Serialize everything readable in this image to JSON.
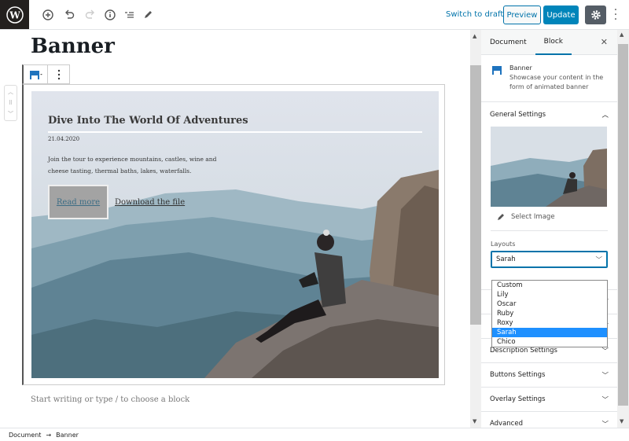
{
  "toolbar": {
    "switch_to_draft": "Switch to draft",
    "preview": "Preview",
    "update": "Update",
    "icons": [
      "wordpress-logo",
      "add-block-icon",
      "undo-icon",
      "redo-icon",
      "info-icon",
      "list-view-icon",
      "edit-icon",
      "gear-icon",
      "more-icon"
    ]
  },
  "post": {
    "title": "Banner",
    "placeholder": "Start writing or type / to choose a block"
  },
  "banner": {
    "heading": "Dive Into The World Of Adventures",
    "date": "21.04.2020",
    "description": "Join the tour to experience mountains, castles, wine and cheese tasting, thermal baths, lakes, waterfalls.",
    "read_more": "Read more",
    "download": "Download the file"
  },
  "sidebar": {
    "tabs": [
      {
        "label": "Document"
      },
      {
        "label": "Block"
      }
    ],
    "active_tab": "Block",
    "block_name": "Banner",
    "block_description": "Showcase your content in the form of animated banner",
    "general_settings": "General Settings",
    "select_image": "Select Image",
    "layouts_label": "Layouts",
    "layout_value": "Sarah",
    "layout_options": [
      "Custom",
      "Lily",
      "Oscar",
      "Ruby",
      "Roxy",
      "Sarah",
      "Chico"
    ],
    "panels": [
      {
        "label": ""
      },
      {
        "label": ""
      },
      {
        "label": "Description Settings"
      },
      {
        "label": "Buttons Settings"
      },
      {
        "label": "Overlay Settings"
      },
      {
        "label": "Advanced"
      }
    ]
  },
  "breadcrumb": {
    "items": [
      "Document",
      "Banner"
    ],
    "separator": "→"
  },
  "colors": {
    "accent": "#0073aa",
    "update": "#0085ba",
    "selected": "#1e90ff"
  }
}
